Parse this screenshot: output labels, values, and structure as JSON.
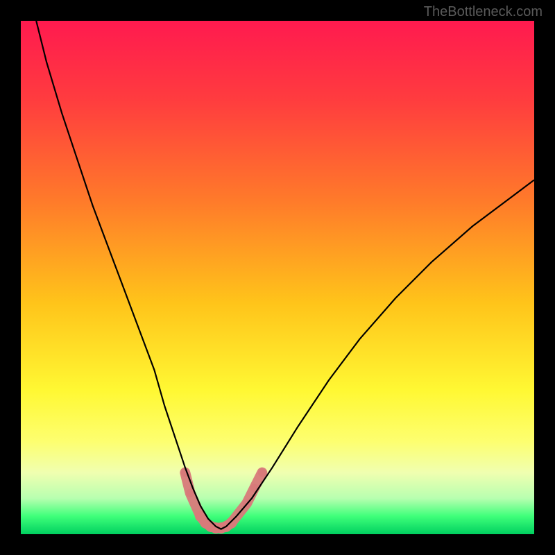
{
  "watermark": "TheBottleneck.com",
  "chart_data": {
    "type": "line",
    "title": "",
    "xlabel": "",
    "ylabel": "",
    "xlim": [
      0,
      100
    ],
    "ylim": [
      0,
      100
    ],
    "gradient_stops": [
      {
        "pos": 0.0,
        "color": "#ff1a4f"
      },
      {
        "pos": 0.15,
        "color": "#ff3b3f"
      },
      {
        "pos": 0.35,
        "color": "#ff7a2a"
      },
      {
        "pos": 0.55,
        "color": "#ffc41a"
      },
      {
        "pos": 0.72,
        "color": "#fff833"
      },
      {
        "pos": 0.82,
        "color": "#fdff70"
      },
      {
        "pos": 0.88,
        "color": "#f0ffb0"
      },
      {
        "pos": 0.93,
        "color": "#b8ffb0"
      },
      {
        "pos": 0.965,
        "color": "#3fff7a"
      },
      {
        "pos": 1.0,
        "color": "#00d060"
      }
    ],
    "series": [
      {
        "name": "bottleneck-curve",
        "color": "#000000",
        "stroke_width": 2.2,
        "x": [
          3,
          5,
          8,
          11,
          14,
          17,
          20,
          23,
          26,
          28,
          30,
          32,
          33.5,
          35,
          36.5,
          38,
          39,
          40,
          42,
          45,
          49,
          54,
          60,
          66,
          73,
          80,
          88,
          96,
          100
        ],
        "y": [
          100,
          92,
          82,
          73,
          64,
          56,
          48,
          40,
          32,
          25,
          19,
          13,
          9,
          5.5,
          3,
          1.5,
          1,
          1.5,
          3.5,
          7,
          13,
          21,
          30,
          38,
          46,
          53,
          60,
          66,
          69
        ]
      }
    ],
    "markers": {
      "name": "valley-markers",
      "color": "#d87a7a",
      "radius_small": 6,
      "radius_seg": 8,
      "points": [
        {
          "x": 32.0,
          "y": 12
        },
        {
          "x": 33.0,
          "y": 8
        },
        {
          "x": 35.0,
          "y": 3.5
        },
        {
          "x": 36.0,
          "y": 2.2
        },
        {
          "x": 37.0,
          "y": 1.5
        },
        {
          "x": 38.0,
          "y": 1.2
        },
        {
          "x": 39.0,
          "y": 1.2
        },
        {
          "x": 40.0,
          "y": 1.5
        },
        {
          "x": 41.0,
          "y": 2.2
        },
        {
          "x": 44.0,
          "y": 6
        },
        {
          "x": 45.5,
          "y": 9
        },
        {
          "x": 47.0,
          "y": 12
        }
      ]
    }
  }
}
